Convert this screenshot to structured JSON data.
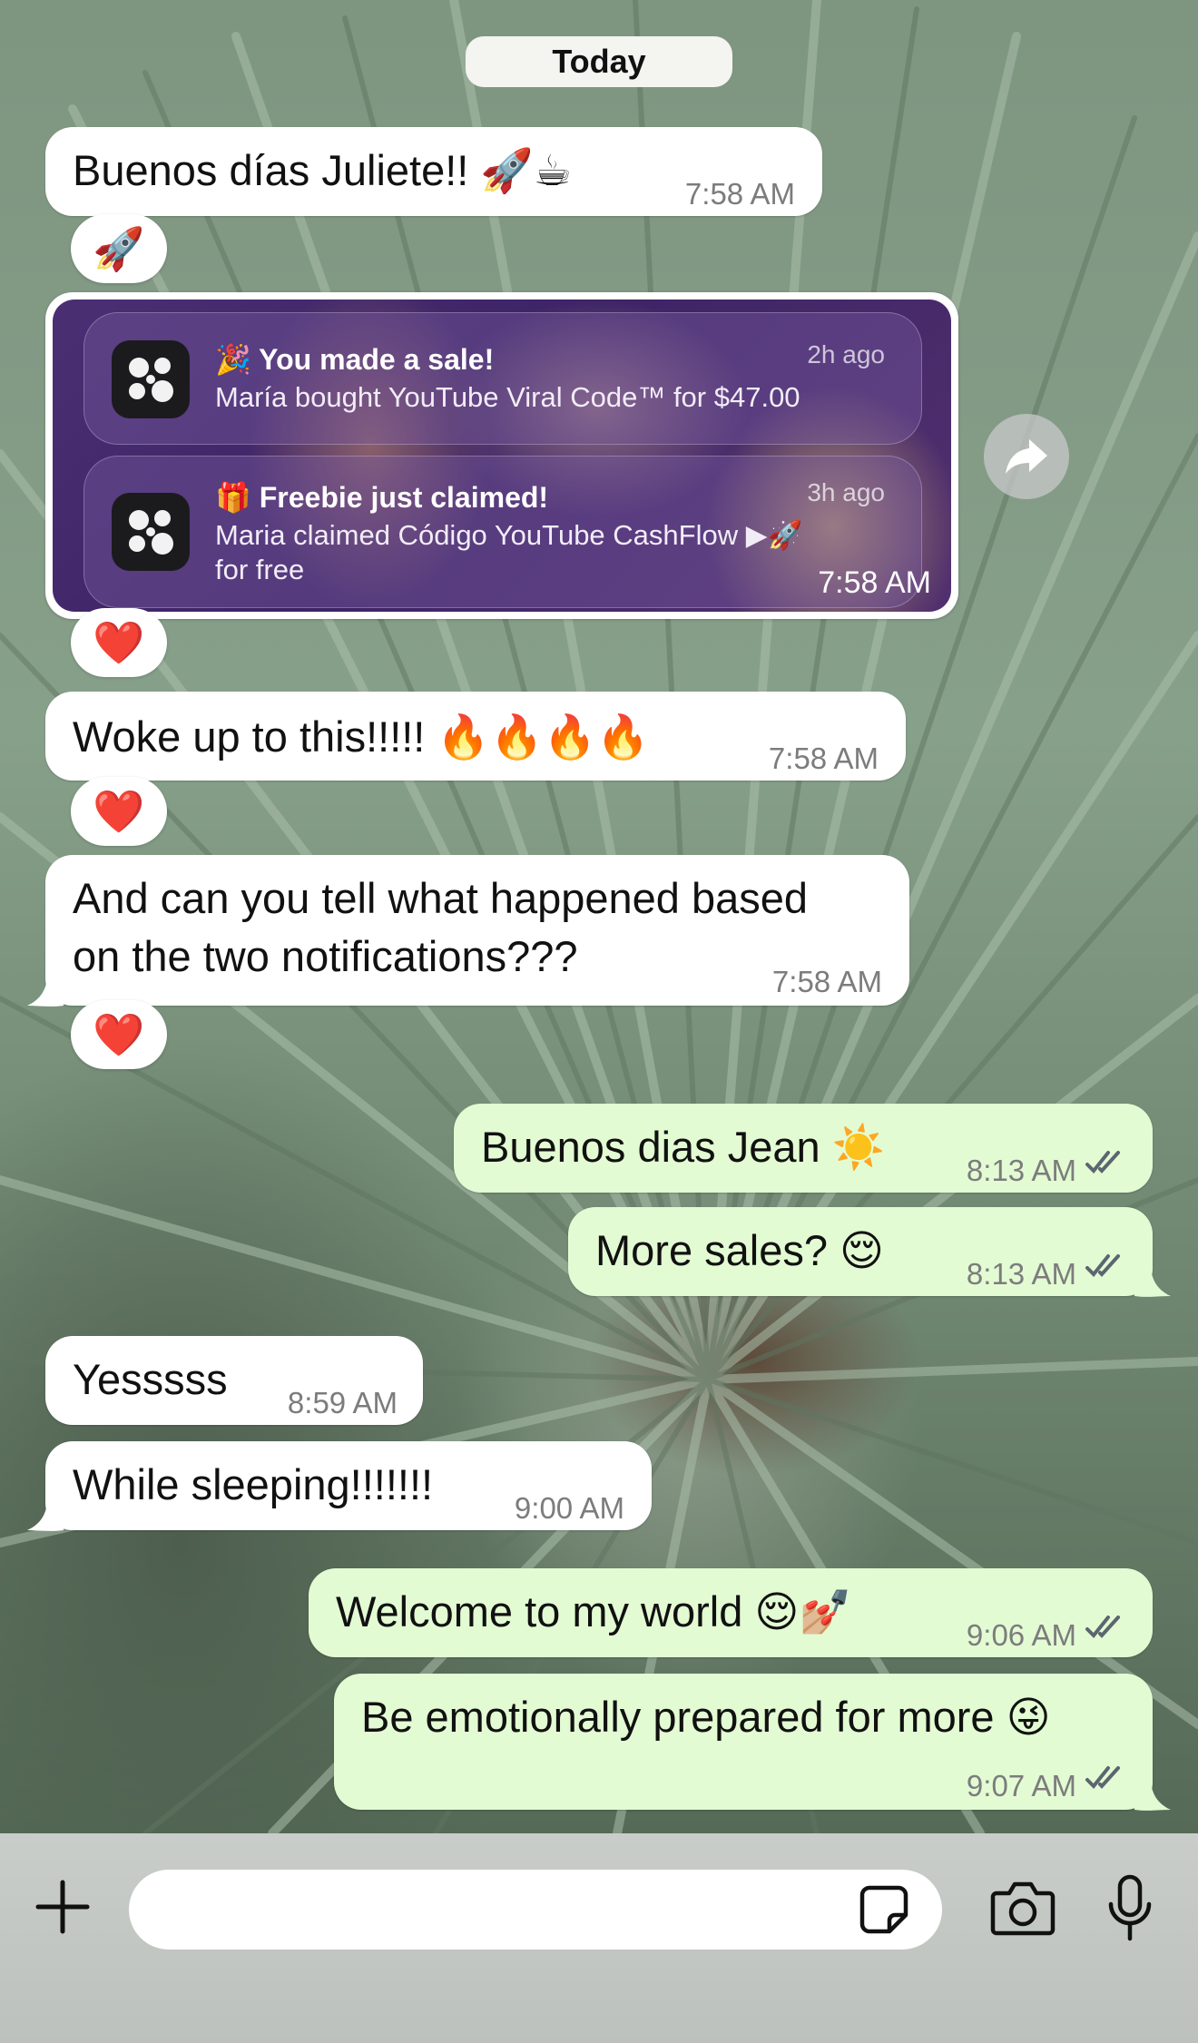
{
  "date_separator": "Today",
  "messages": [
    {
      "id": 1,
      "dir": "in",
      "text": "Buenos días Juliete!! 🚀☕",
      "time": "7:58 AM",
      "reaction": "🚀"
    },
    {
      "id": 2,
      "dir": "in",
      "type": "image",
      "time": "7:58 AM",
      "reaction": "❤️",
      "notifications": [
        {
          "title": "🎉 You made a sale!",
          "body": "María bought YouTube Viral Code™ for $47.00",
          "ago": "2h ago"
        },
        {
          "title": "🎁 Freebie just claimed!",
          "body_line1": "Maria claimed Código YouTube CashFlow ▶🚀",
          "body_line2": "for free",
          "ago": "3h ago"
        }
      ]
    },
    {
      "id": 3,
      "dir": "in",
      "text": "Woke up to this!!!!! 🔥🔥🔥🔥",
      "time": "7:58 AM",
      "reaction": "❤️"
    },
    {
      "id": 4,
      "dir": "in",
      "line1": "And can you tell what happened based",
      "line2": "on the two notifications???",
      "time": "7:58 AM",
      "reaction": "❤️"
    },
    {
      "id": 5,
      "dir": "out",
      "text": "Buenos dias Jean ☀️",
      "time": "8:13 AM"
    },
    {
      "id": 6,
      "dir": "out",
      "text": "More sales? 😌",
      "time": "8:13 AM"
    },
    {
      "id": 7,
      "dir": "in",
      "text": "Yesssss",
      "time": "8:59 AM"
    },
    {
      "id": 8,
      "dir": "in",
      "text": "While sleeping!!!!!!!",
      "time": "9:00 AM"
    },
    {
      "id": 9,
      "dir": "out",
      "text": "Welcome to my world 😌💅🏼",
      "time": "9:06 AM"
    },
    {
      "id": 10,
      "dir": "out",
      "text": "Be emotionally prepared for more 😜",
      "time": "9:07 AM"
    }
  ],
  "composer": {
    "placeholder": "",
    "value": ""
  },
  "icons": {
    "plus": "plus-icon",
    "sticker": "sticker-icon",
    "camera": "camera-icon",
    "mic": "microphone-icon",
    "share": "share-forward-icon",
    "read": "double-check-icon"
  },
  "colors": {
    "incoming_bubble": "#ffffff",
    "outgoing_bubble": "#e3fbd3",
    "read_ticks": "#5b6670",
    "notification_bg": "#3d2466"
  }
}
